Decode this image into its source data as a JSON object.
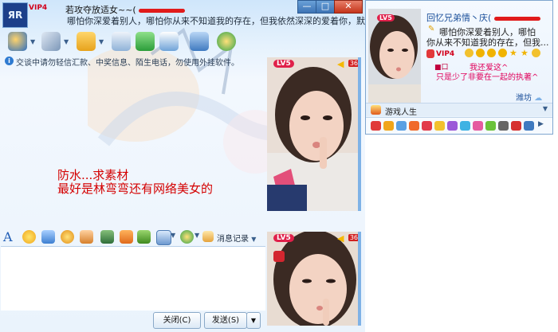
{
  "chat": {
    "vip_badge": "VIP4",
    "contact_name": "若攻夺放适女~~(",
    "signature": "哪怕你深爱着别人，哪怕你从来不知道我的存在，但我依然深深的爱着你，默默的",
    "avatar_text": "ЯR",
    "window_controls": [
      "—",
      "□",
      "✕"
    ],
    "notice": "交谈中请勿轻信汇款、中奖信息、陌生电话，勿使用外挂软件。",
    "messages": [
      "防水...求素材",
      "最好是林弯弯还有网络美女的"
    ],
    "history_label": "消息记录",
    "close_button": "关闭(C)",
    "send_button": "发送(S)",
    "video_top": {
      "level": "LV5",
      "num": "36"
    },
    "video_bottom": {
      "level": "LV5",
      "num": "36"
    }
  },
  "profile": {
    "name": "回忆兄弟情丶庆(",
    "sig_line1": "哪怕你深爱着别人，哪怕",
    "sig_line2": "你从来不知道我的存在，但我...",
    "vip": "VIP4",
    "level": "LV5",
    "status": "■口",
    "line1": "我还爱这^",
    "line2": "只是少了非要在一起的执著^",
    "weather": "潍坊",
    "game": "游戏人生"
  },
  "colors": {
    "accent": "#2e7bd1",
    "message_red": "#d40000",
    "pink_text": "#e0005a"
  }
}
